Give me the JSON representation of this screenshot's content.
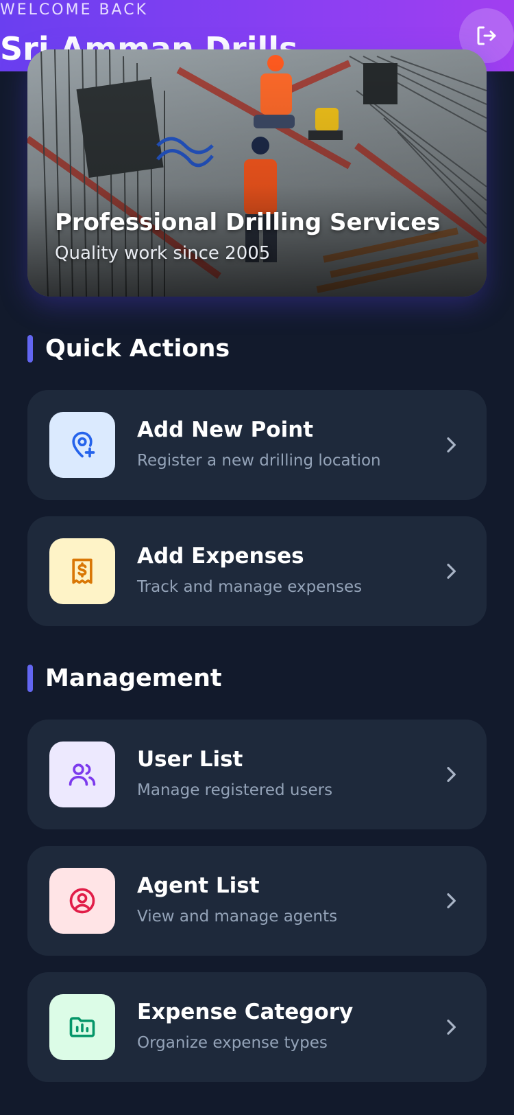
{
  "header": {
    "welcome": "WELCOME BACK",
    "company": "Sri Amman Drills"
  },
  "hero": {
    "title": "Professional Drilling Services",
    "subtitle": "Quality work since 2005"
  },
  "quick_actions": {
    "heading": "Quick Actions",
    "items": [
      {
        "title": "Add New Point",
        "desc": "Register a new drilling location",
        "icon": "map-pin-plus-icon",
        "icon_bg": "#dbeafe",
        "icon_color": "#2563eb"
      },
      {
        "title": "Add Expenses",
        "desc": "Track and manage expenses",
        "icon": "receipt-dollar-icon",
        "icon_bg": "#fef3c7",
        "icon_color": "#d97706"
      }
    ]
  },
  "management": {
    "heading": "Management",
    "items": [
      {
        "title": "User List",
        "desc": "Manage registered users",
        "icon": "users-icon",
        "icon_bg": "#ede9fe",
        "icon_color": "#7c3aed"
      },
      {
        "title": "Agent List",
        "desc": "View and manage agents",
        "icon": "user-circle-icon",
        "icon_bg": "#ffe4e6",
        "icon_color": "#e11d48"
      },
      {
        "title": "Expense Category",
        "desc": "Organize expense types",
        "icon": "folder-chart-icon",
        "icon_bg": "#dcfce7",
        "icon_color": "#059669"
      }
    ]
  },
  "colors": {
    "background": "#121a2c",
    "card": "#1e293b",
    "accent": "#6366f1",
    "header_gradient_start": "#6a3ff0",
    "header_gradient_end": "#a13ff0"
  }
}
